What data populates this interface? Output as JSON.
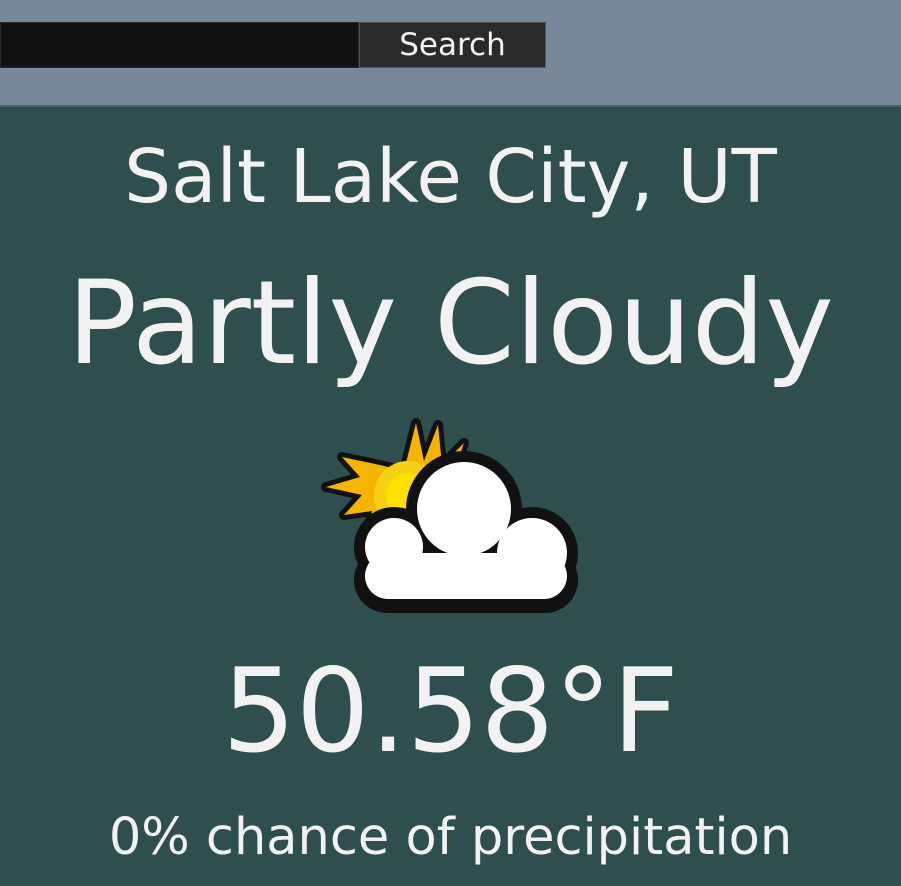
{
  "search": {
    "value": "",
    "button_label": "Search"
  },
  "weather": {
    "location": "Salt Lake City, UT",
    "condition": "Partly Cloudy",
    "icon": "partly-cloudy-icon",
    "temperature": "50.58°F",
    "precipitation": "0% chance of precipitation"
  },
  "colors": {
    "header_background": "#778899",
    "page_background": "#2f4f4f",
    "text": "#f2f2f2",
    "search_field": "#111111",
    "search_button": "#2a2a2a"
  }
}
